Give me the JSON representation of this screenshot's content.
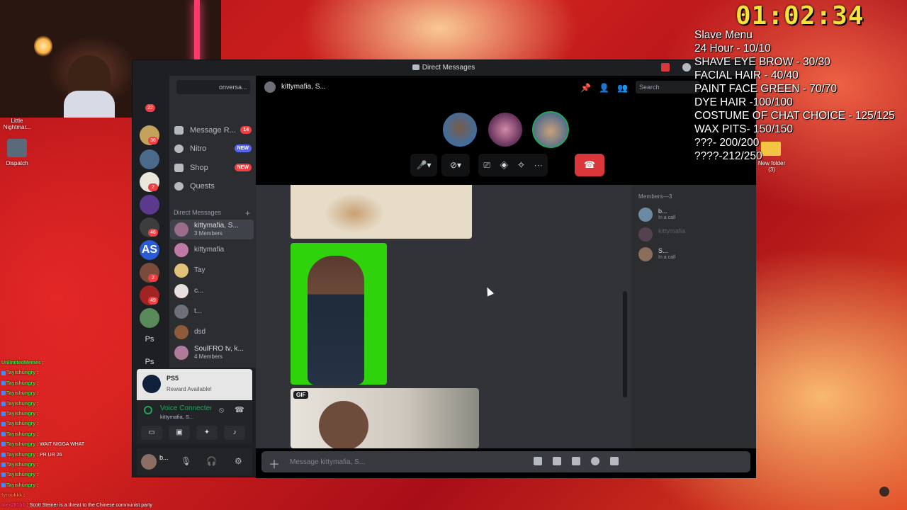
{
  "overlay": {
    "timer": "01:02:34",
    "menu": [
      "Slave Menu",
      "24 Hour - 10/10",
      "SHAVE EYE BROW - 30/30",
      "FACIAL HAIR - 40/40",
      "PAINT FACE GREEN - 70/70",
      "DYE HAIR -100/100",
      "COSTUME OF CHAT CHOICE - 125/125",
      "WAX PITS- 150/150",
      "???- 200/200",
      "????-212/250"
    ]
  },
  "desktop": {
    "icons": [
      {
        "label": "Little Nightmar..."
      },
      {
        "label": "Dispatch"
      },
      {
        "label": "New folder (3)"
      }
    ]
  },
  "window": {
    "title": "Direct Messages"
  },
  "servers": {
    "badges": [
      "36",
      "2",
      "46",
      "2",
      "49"
    ],
    "labels": [
      "AS",
      "Ps",
      "Ps"
    ],
    "friends_badge": "22"
  },
  "sidebar": {
    "search_placeholder": "onversa...",
    "nav": [
      {
        "label": "Message R...",
        "badge": "14",
        "badge_color": "#f23f43"
      },
      {
        "label": "Nitro",
        "badge": "NEW",
        "badge_color": "#5865f2"
      },
      {
        "label": "Shop",
        "badge": "NEW",
        "badge_color": "#f23f43"
      },
      {
        "label": "Quests",
        "badge": "",
        "badge_color": ""
      }
    ],
    "dm_header": "Direct Messages",
    "dm_add": "+",
    "dms": [
      {
        "name": "kittymafia, S...",
        "sub": "3 Members"
      },
      {
        "name": "kittymafia",
        "sub": ""
      },
      {
        "name": "Tay",
        "sub": ""
      },
      {
        "name": "c...",
        "sub": ""
      },
      {
        "name": "t...",
        "sub": ""
      },
      {
        "name": "dsd",
        "sub": ""
      },
      {
        "name": "SoulFRO tv, k...",
        "sub": "4 Members"
      }
    ]
  },
  "ps_notice": {
    "title": "PS5",
    "text": "Reward Available!"
  },
  "voice": {
    "status": "Voice Connected",
    "channel": "kittymafia, S..."
  },
  "user": {
    "name": "b..."
  },
  "chat": {
    "channel_name": "kittymafia, S...",
    "search_placeholder": "Search",
    "gif_label": "GIF",
    "composer_placeholder": "Message kittymafia, S..."
  },
  "members": {
    "header": "Members—3",
    "list": [
      {
        "name": "b...",
        "status": "In a call"
      },
      {
        "name": "kittymafia",
        "status": ""
      },
      {
        "name": "S...",
        "status": "In a call"
      }
    ]
  },
  "stream_chat": [
    {
      "user": "UnlimitedMemes",
      "msg": ":"
    },
    {
      "user": "Tayishungry",
      "msg": ":"
    },
    {
      "user": "Tayishungry",
      "msg": ":"
    },
    {
      "user": "Tayishungry",
      "msg": ":"
    },
    {
      "user": "Tayishungry",
      "msg": ":"
    },
    {
      "user": "Tayishungry",
      "msg": ":"
    },
    {
      "user": "Tayishungry",
      "msg": ":"
    },
    {
      "user": "Tayishungry",
      "msg": ":"
    },
    {
      "user": "Tayishungry",
      "msg": ": WAIT NIGGA WHAT"
    },
    {
      "user": "Tayishungry",
      "msg": ": PR UR 26"
    },
    {
      "user": "Tayishungry",
      "msg": ":"
    },
    {
      "user": "Tayishungry",
      "msg": ":"
    },
    {
      "user": "Tayishungry",
      "msg": ":"
    },
    {
      "user": "tyrookkk",
      "msg": ":"
    },
    {
      "user": "alex281bb",
      "msg": ": Scott Steiner is a threat to the Chinese communist party"
    }
  ]
}
